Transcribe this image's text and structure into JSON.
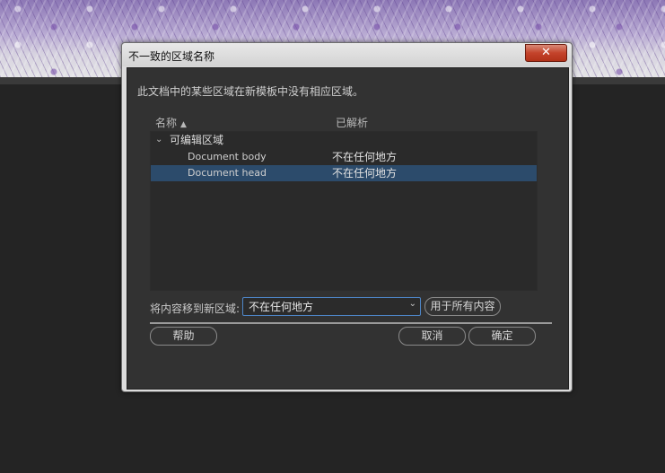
{
  "dialog": {
    "title": "不一致的区域名称",
    "close_label": "✕",
    "description": "此文档中的某些区域在新模板中没有相应区域。"
  },
  "columns": {
    "name": "名称",
    "resolved": "已解析"
  },
  "tree": {
    "group_label": "可编辑区域",
    "rows": [
      {
        "name": "Document body",
        "resolved": "不在任何地方",
        "selected": false
      },
      {
        "name": "Document head",
        "resolved": "不在任何地方",
        "selected": true
      }
    ]
  },
  "move": {
    "label": "将内容移到新区域:",
    "selected": "不在任何地方",
    "apply_all_label": "用于所有内容"
  },
  "buttons": {
    "help": "帮助",
    "cancel": "取消",
    "ok": "确定"
  },
  "colors": {
    "selection": "#2c4b6b",
    "dropdown_border": "#4e86c8",
    "close_button": "#c4432b"
  }
}
